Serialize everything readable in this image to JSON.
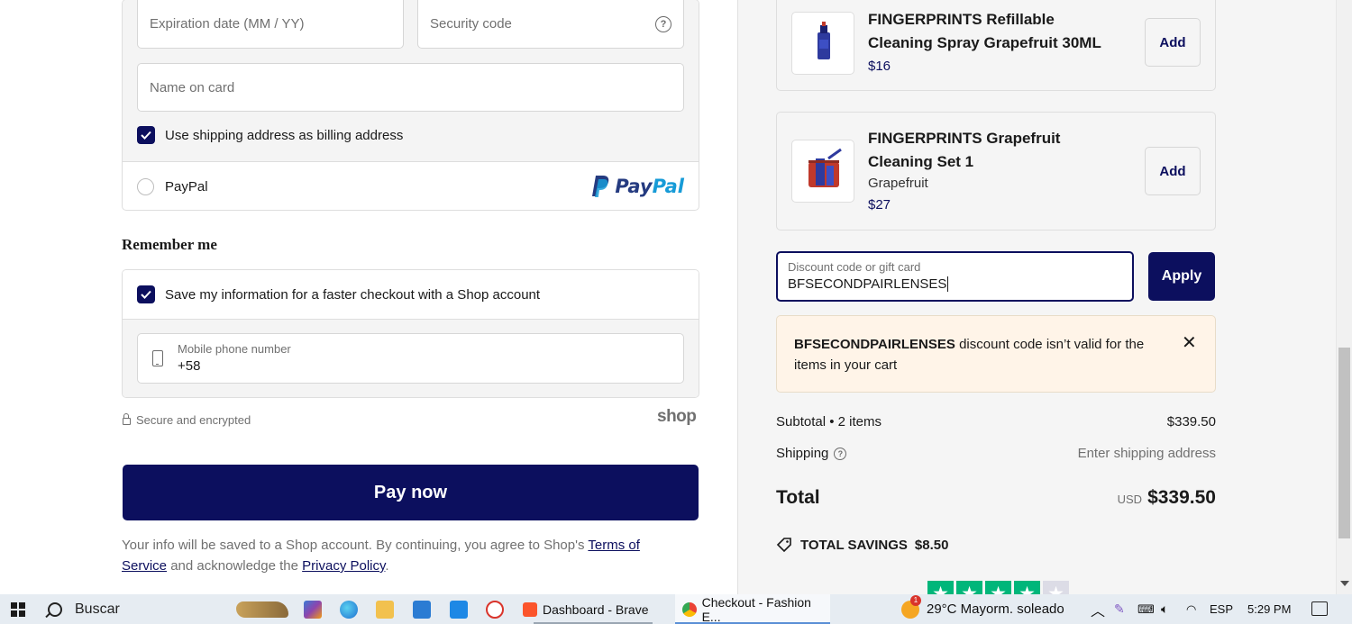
{
  "payment": {
    "expiration_placeholder": "Expiration date (MM / YY)",
    "security_placeholder": "Security code",
    "security_help": "?",
    "name_placeholder": "Name on card",
    "billing_checkbox_label": "Use shipping address as billing address",
    "billing_checked": true,
    "paypal_label": "PayPal",
    "paypal_logo_text_1": "Pay",
    "paypal_logo_text_2": "Pal"
  },
  "remember": {
    "heading": "Remember me",
    "save_label": "Save my information for a faster checkout with a Shop account",
    "save_checked": true,
    "phone_label": "Mobile phone number",
    "phone_value": "+58"
  },
  "footer": {
    "secure_text": "Secure and encrypted",
    "shop_logo": "shop",
    "pay_button": "Pay now",
    "terms_prefix": "Your info will be saved to a Shop account. By continuing, you agree to Shop's ",
    "terms_link": "Terms of Service",
    "terms_middle": " and acknowledge the ",
    "privacy_link": "Privacy Policy",
    "terms_suffix": "."
  },
  "upsell": [
    {
      "name": "FINGERPRINTS Refillable Cleaning Spray Grapefruit 30ML",
      "variant": "",
      "price": "$16",
      "add_label": "Add"
    },
    {
      "name": "FINGERPRINTS Grapefruit Cleaning Set 1",
      "variant": "Grapefruit",
      "price": "$27",
      "add_label": "Add"
    }
  ],
  "discount": {
    "label": "Discount code or gift card",
    "value": "BFSECONDPAIRLENSES",
    "apply_label": "Apply",
    "error_code": "BFSECONDPAIRLENSES",
    "error_message": " discount code isn’t valid for the items in your cart",
    "close": "✕"
  },
  "summary": {
    "subtotal_label": "Subtotal • 2 items",
    "subtotal_value": "$339.50",
    "shipping_label": "Shipping",
    "shipping_help": "?",
    "shipping_value": "Enter shipping address",
    "total_label": "Total",
    "currency": "USD",
    "total_value": "$339.50",
    "savings_label": "TOTAL SAVINGS",
    "savings_value": "$8.50",
    "rating_stars": 4,
    "rating_max": 5
  },
  "taskbar": {
    "search_placeholder": "Buscar",
    "app_brave": "Dashboard - Brave",
    "app_chrome": "Checkout - Fashion E...",
    "weather_badge": "1",
    "weather": "29°C  Mayorm. soleado",
    "lang": "ESP",
    "time": "5:29 PM"
  },
  "colors": {
    "brand": "#0c0f5e",
    "alert_bg": "#fff4e8",
    "trustpilot_green": "#00b67a"
  }
}
